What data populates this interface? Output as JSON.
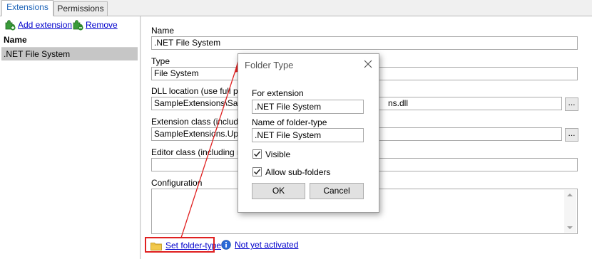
{
  "tabs": [
    {
      "label": "Extensions",
      "active": true
    },
    {
      "label": "Permissions",
      "active": false
    }
  ],
  "toolbar": {
    "add_label": "Add extension",
    "remove_label": "Remove"
  },
  "list": {
    "header": "Name",
    "rows": [
      ".NET File System"
    ]
  },
  "form": {
    "name_label": "Name",
    "name_value": ".NET File System",
    "type_label": "Type",
    "type_value": "File System",
    "dll_label": "DLL location (use full path",
    "dll_value_left": "SampleExtensions\\Sampl",
    "dll_value_right": "ns.dll",
    "ext_class_label": "Extension class (including",
    "ext_class_value": "SampleExtensions.Upper",
    "editor_class_label": "Editor class (including nam",
    "editor_class_value": "",
    "config_label": "Configuration",
    "browse_label": "..."
  },
  "bottom": {
    "set_folder_type": "Set folder-type",
    "not_activated": "Not yet activated"
  },
  "dialog": {
    "title": "Folder Type",
    "for_extension_label": "For extension",
    "for_extension_value": ".NET File System",
    "folder_type_name_label": "Name of folder-type",
    "folder_type_name_value": ".NET File System",
    "visible_label": "Visible",
    "visible_checked": true,
    "allow_subfolders_label": "Allow sub-folders",
    "allow_subfolders_checked": true,
    "ok_label": "OK",
    "cancel_label": "Cancel"
  },
  "colors": {
    "link": "#0000cc",
    "active_tab_text": "#1c63b7",
    "selected_row": "#c6c6c6",
    "annotation_red": "#e02020",
    "info_blue": "#2a6ad8"
  }
}
